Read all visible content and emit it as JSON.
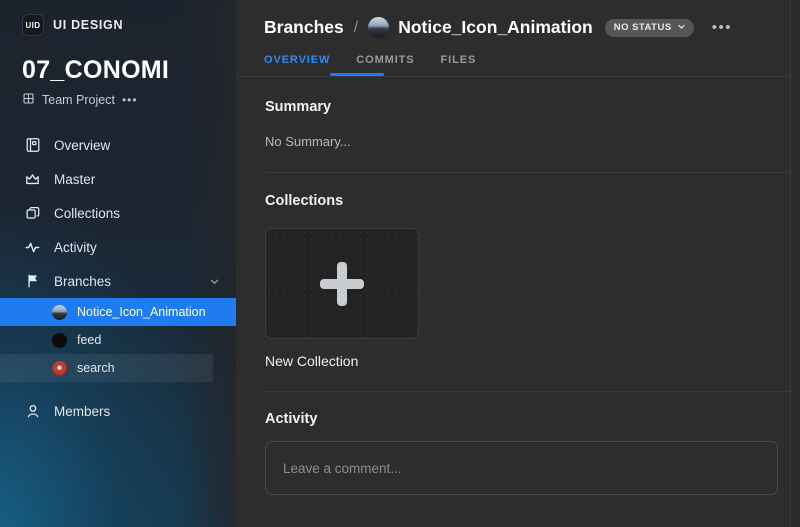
{
  "sidebar": {
    "brand": {
      "logo_text": "UID",
      "name": "UI DESIGN"
    },
    "project": {
      "title": "07_CONOMI",
      "meta_label": "Team Project",
      "more_dots": "•••"
    },
    "nav_items": [
      {
        "label": "Overview",
        "icon": "overview-icon"
      },
      {
        "label": "Master",
        "icon": "crown-icon"
      },
      {
        "label": "Collections",
        "icon": "collections-icon"
      },
      {
        "label": "Activity",
        "icon": "activity-icon"
      },
      {
        "label": "Branches",
        "icon": "branch-icon",
        "chevron": "chevron-down-icon"
      }
    ],
    "branches": [
      {
        "label": "Notice_Icon_Animation",
        "avatar": "photo",
        "state": "selected"
      },
      {
        "label": "feed",
        "avatar": "black",
        "state": "default"
      },
      {
        "label": "search",
        "avatar": "red",
        "state": "hovered"
      }
    ],
    "members": {
      "label": "Members",
      "icon": "person-icon"
    }
  },
  "header": {
    "breadcrumb_root": "Branches",
    "breadcrumb_separator": "/",
    "title": "Notice_Icon_Animation",
    "status_label": "NO STATUS",
    "status_chevron": "⌄",
    "more_dots": "•••"
  },
  "tabs": [
    {
      "label": "OVERVIEW",
      "active": true
    },
    {
      "label": "COMMITS",
      "active": false
    },
    {
      "label": "FILES",
      "active": false
    }
  ],
  "summary": {
    "heading": "Summary",
    "body": "No Summary..."
  },
  "collections": {
    "heading": "Collections",
    "new_tile_label": "New Collection",
    "plus_icon": "plus-icon"
  },
  "activity": {
    "heading": "Activity",
    "comment_placeholder": "Leave a comment...",
    "comment_value": ""
  },
  "colors": {
    "accent_blue": "#1e7cf0",
    "tab_active": "#2f8bf5",
    "main_bg": "#2d2d2d",
    "tile_bg": "#232323",
    "status_pill": "#565656"
  }
}
